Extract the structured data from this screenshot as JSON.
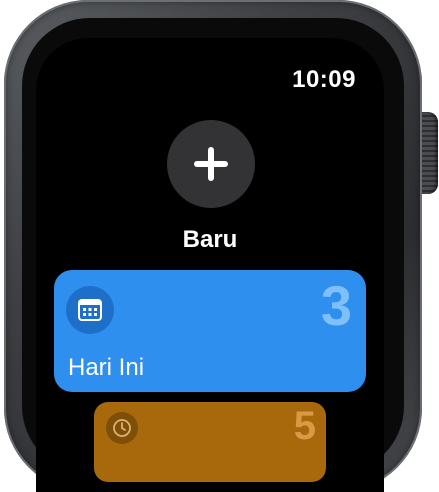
{
  "status": {
    "time": "10:09"
  },
  "new_item": {
    "label": "Baru",
    "icon": "plus-icon"
  },
  "lists": [
    {
      "title": "Hari Ini",
      "count": "3",
      "icon": "calendar-icon",
      "color": "#2f8fef"
    },
    {
      "title": "",
      "count": "5",
      "icon": "clock-icon",
      "color": "#a8690d"
    }
  ],
  "device": {
    "case_color": "#3d3f42"
  }
}
